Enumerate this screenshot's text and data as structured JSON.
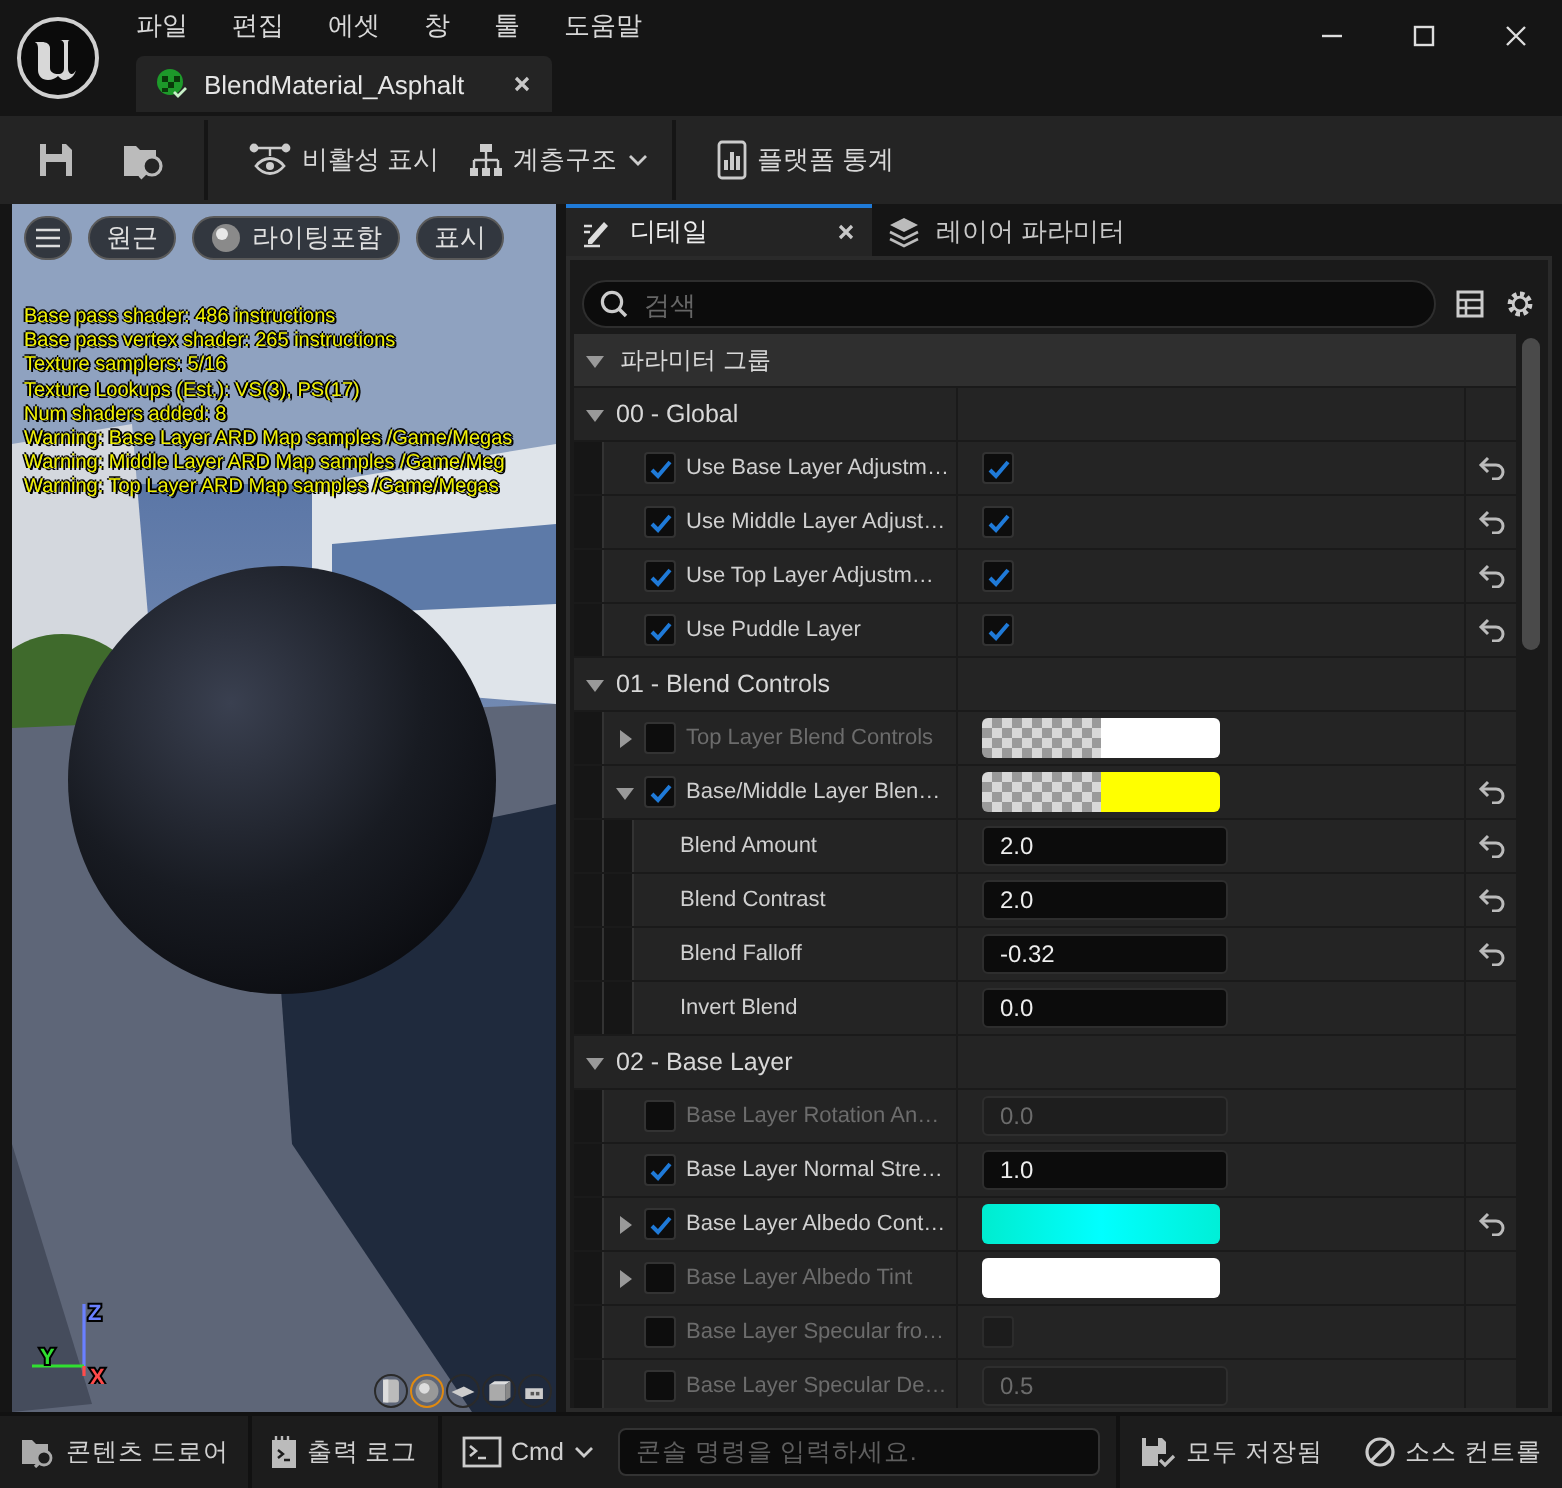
{
  "title_bar": {
    "menus": [
      "파일",
      "편집",
      "에셋",
      "창",
      "툴",
      "도움말"
    ],
    "document_tab": {
      "title": "BlendMaterial_Asphalt"
    }
  },
  "toolbar": {
    "buttons": [
      {
        "label": "비활성 표시",
        "dropdown": false
      },
      {
        "label": "계층구조",
        "dropdown": true
      },
      {
        "label": "플랫폼 통계",
        "dropdown": false
      }
    ]
  },
  "viewport": {
    "buttons": [
      {
        "label": "원근"
      },
      {
        "label": "라이팅포함"
      },
      {
        "label": "표시"
      }
    ],
    "stats": [
      "Base pass shader: 486 instructions",
      "Base pass vertex shader: 265 instructions",
      "Texture samplers: 5/16",
      "Texture Lookups (Est.): VS(3), PS(17)",
      "Num shaders added: 8",
      "Warning: Base Layer ARD Map samples /Game/Megas",
      "Warning: Middle Layer ARD Map samples /Game/Meg",
      "Warning: Top Layer ARD Map samples /Game/Megas"
    ],
    "axes": [
      {
        "label": "Z",
        "color": "#6a80ff"
      },
      {
        "label": "Y",
        "color": "#30e030"
      },
      {
        "label": "X",
        "color": "#ff4a4a"
      }
    ],
    "preview_shapes": [
      {
        "kind": "cylinder",
        "selected": false
      },
      {
        "kind": "sphere",
        "selected": true
      },
      {
        "kind": "plane",
        "selected": false
      },
      {
        "kind": "cube",
        "selected": false
      },
      {
        "kind": "teapot",
        "selected": false
      }
    ]
  },
  "details": {
    "tabs": [
      {
        "label": "디테일",
        "selected": true
      },
      {
        "label": "레이어 파라미터",
        "selected": false
      }
    ],
    "search": {
      "placeholder": "검색"
    },
    "header": {
      "label": "파라미터 그룹",
      "expanded": true
    },
    "groups": [
      {
        "label": "00 - Global",
        "expanded": true,
        "params": [
          {
            "label": "Use Base Layer Adjustm…",
            "override": true,
            "enabled": true,
            "value": {
              "kind": "bool",
              "checked": true
            },
            "reset": true
          },
          {
            "label": "Use Middle Layer Adjust…",
            "override": true,
            "enabled": true,
            "value": {
              "kind": "bool",
              "checked": true
            },
            "reset": true
          },
          {
            "label": "Use Top Layer Adjustm…",
            "override": true,
            "enabled": true,
            "value": {
              "kind": "bool",
              "checked": true
            },
            "reset": true
          },
          {
            "label": "Use Puddle Layer",
            "override": true,
            "enabled": true,
            "value": {
              "kind": "bool",
              "checked": true
            },
            "reset": true
          }
        ]
      },
      {
        "label": "01 - Blend Controls",
        "expanded": true,
        "params": [
          {
            "label": "Top Layer Blend Controls",
            "expanded": false,
            "override": false,
            "enabled": false,
            "value": {
              "kind": "color",
              "color": "#ffffff",
              "translucent": true
            },
            "reset": false
          },
          {
            "label": "Base/Middle Layer Blen…",
            "expanded": true,
            "override": true,
            "enabled": true,
            "value": {
              "kind": "color",
              "color": "#ffff00",
              "translucent": true
            },
            "reset": true,
            "children": [
              {
                "label": "Blend Amount",
                "enabled": true,
                "value": {
                  "kind": "number",
                  "text": "2.0"
                },
                "reset": true
              },
              {
                "label": "Blend Contrast",
                "enabled": true,
                "value": {
                  "kind": "number",
                  "text": "2.0"
                },
                "reset": true
              },
              {
                "label": "Blend Falloff",
                "enabled": true,
                "value": {
                  "kind": "number",
                  "text": "-0.32"
                },
                "reset": true
              },
              {
                "label": "Invert Blend",
                "enabled": true,
                "value": {
                  "kind": "number",
                  "text": "0.0"
                },
                "reset": false
              }
            ]
          }
        ]
      },
      {
        "label": "02 - Base Layer",
        "expanded": true,
        "params": [
          {
            "label": "Base Layer Rotation An…",
            "override": false,
            "enabled": false,
            "value": {
              "kind": "number",
              "text": "0.0"
            },
            "reset": false
          },
          {
            "label": "Base Layer Normal Stre…",
            "override": true,
            "enabled": true,
            "value": {
              "kind": "number",
              "text": "1.0"
            },
            "reset": false
          },
          {
            "label": "Base Layer Albedo Cont…",
            "expanded": false,
            "override": true,
            "enabled": true,
            "value": {
              "kind": "gradient",
              "color": "#00ffff"
            },
            "reset": true
          },
          {
            "label": "Base Layer Albedo Tint",
            "expanded": false,
            "override": false,
            "enabled": false,
            "value": {
              "kind": "color",
              "color": "#ffffff",
              "translucent": false
            },
            "reset": false
          },
          {
            "label": "Base Layer Specular fro…",
            "override": false,
            "enabled": false,
            "value": {
              "kind": "bool",
              "checked": false
            },
            "reset": false
          },
          {
            "label": "Base Layer Specular De…",
            "override": false,
            "enabled": false,
            "value": {
              "kind": "number",
              "text": "0.5"
            },
            "reset": false
          }
        ]
      }
    ]
  },
  "status_bar": {
    "left": [
      {
        "label": "콘텐츠 드로어"
      },
      {
        "label": "출력 로그"
      }
    ],
    "cmd": {
      "label": "Cmd"
    },
    "console": {
      "placeholder": "콘솔 명령을 입력하세요."
    },
    "right": [
      {
        "label": "모두 저장됨"
      },
      {
        "label": "소스 컨트롤"
      }
    ]
  }
}
